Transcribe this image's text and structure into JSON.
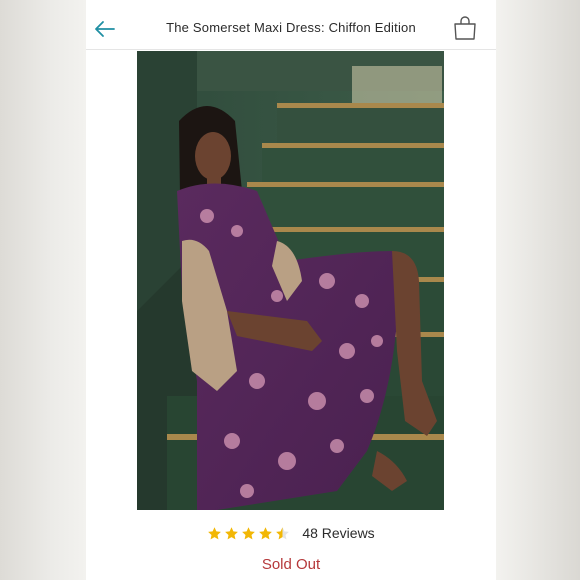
{
  "header": {
    "title": "The Somerset Maxi Dress: Chiffon Edition",
    "back_icon": "arrow-left-icon",
    "bag_icon": "shopping-bag-icon"
  },
  "product": {
    "rating": 4.5,
    "rating_max": 5,
    "reviews_label": "48 Reviews",
    "status": "Sold Out"
  },
  "colors": {
    "accent": "#1f8fa3",
    "star": "#f2b705",
    "sold_out": "#b5383a"
  }
}
